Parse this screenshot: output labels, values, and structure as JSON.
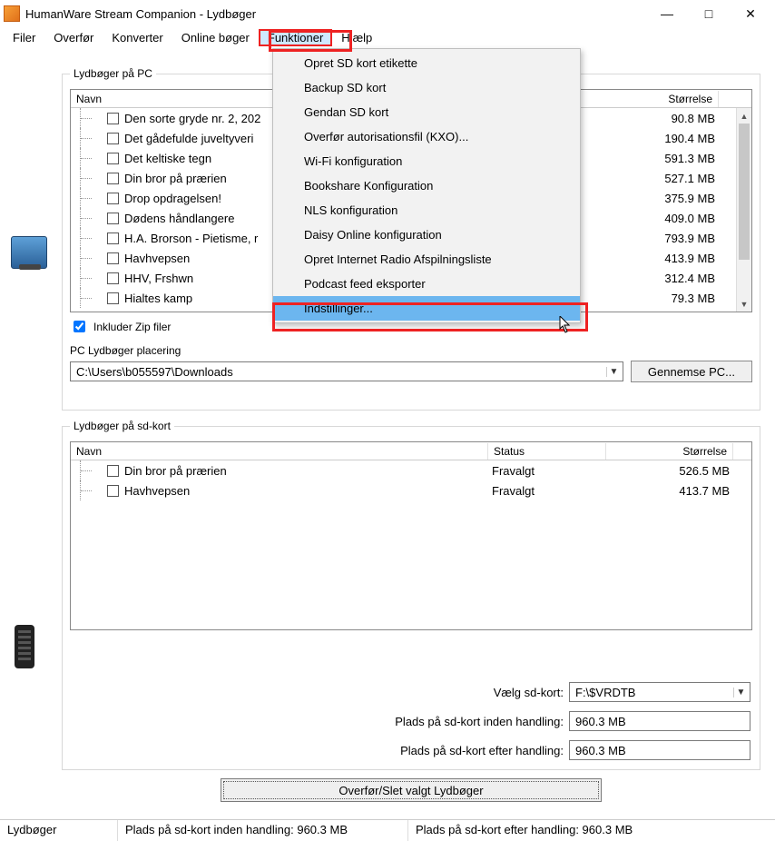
{
  "window": {
    "title": "HumanWare Stream Companion - Lydbøger"
  },
  "menubar": {
    "items": [
      "Filer",
      "Overfør",
      "Konverter",
      "Online bøger",
      "Funktioner",
      "Hjælp"
    ],
    "open_index": 4
  },
  "dropdown": {
    "items": [
      "Opret SD kort etikette",
      "Backup SD kort",
      "Gendan SD kort",
      "Overfør autorisationsfil (KXO)...",
      "Wi-Fi konfiguration",
      "Bookshare Konfiguration",
      "NLS konfiguration",
      "Daisy Online konfiguration",
      "Opret Internet Radio Afspilningsliste",
      "Podcast feed eksporter",
      "Indstillinger..."
    ],
    "selected_index": 10
  },
  "pc_group": {
    "legend": "Lydbøger på PC",
    "columns": {
      "name": "Navn",
      "size": "Størrelse"
    },
    "rows": [
      {
        "name": "Den sorte gryde nr. 2, 202",
        "size": "90.8 MB"
      },
      {
        "name": "Det gådefulde juveltyveri",
        "size": "190.4 MB"
      },
      {
        "name": "Det keltiske tegn",
        "size": "591.3 MB"
      },
      {
        "name": "Din bror på prærien",
        "size": "527.1 MB"
      },
      {
        "name": "Drop opdragelsen!",
        "size": "375.9 MB"
      },
      {
        "name": "Dødens håndlangere",
        "size": "409.0 MB"
      },
      {
        "name": "H.A. Brorson - Pietisme, r",
        "size": "793.9 MB"
      },
      {
        "name": "Havhvepsen",
        "size": "413.9 MB"
      },
      {
        "name": "HHV, Frshwn",
        "size": "312.4 MB"
      },
      {
        "name": "Hialtes kamp",
        "size": "79.3 MB"
      }
    ],
    "include_zip_label": "Inkluder Zip filer",
    "include_zip_checked": true,
    "path_label": "PC Lydbøger placering",
    "path_value": "C:\\Users\\b055597\\Downloads",
    "browse_label": "Gennemse PC..."
  },
  "sd_group": {
    "legend": "Lydbøger på sd-kort",
    "columns": {
      "name": "Navn",
      "status": "Status",
      "size": "Størrelse"
    },
    "rows": [
      {
        "name": "Din bror på prærien",
        "status": "Fravalgt",
        "size": "526.5 MB"
      },
      {
        "name": "Havhvepsen",
        "status": "Fravalgt",
        "size": "413.7 MB"
      }
    ],
    "select_card_label": "Vælg sd-kort:",
    "select_card_value": "F:\\$VRDTB",
    "space_before_label": "Plads på sd-kort inden handling:",
    "space_before_value": "960.3 MB",
    "space_after_label": "Plads på sd-kort efter handling:",
    "space_after_value": "960.3 MB"
  },
  "transfer_button": "Overfør/Slet valgt Lydbøger",
  "statusbar": {
    "tab": "Lydbøger",
    "before": "Plads på sd-kort inden handling: 960.3 MB",
    "after": "Plads på sd-kort efter handling: 960.3 MB"
  }
}
